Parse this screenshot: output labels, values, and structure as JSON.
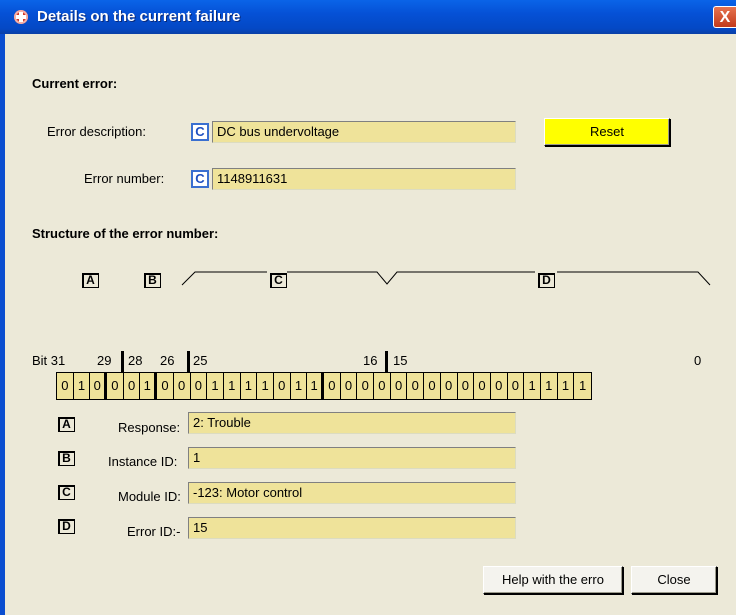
{
  "window": {
    "title": "Details on the current failure",
    "close_glyph": "X"
  },
  "current": {
    "heading": "Current error:",
    "desc_label": "Error description:",
    "desc_value": "DC bus undervoltage",
    "number_label": "Error number:",
    "number_value": "1148911631",
    "c_badge": "C",
    "reset_label": "Reset"
  },
  "structure": {
    "heading": "Structure of the error number:",
    "group_labels": [
      "A",
      "B",
      "C",
      "D"
    ],
    "bit_labels": [
      "Bit 31",
      "29",
      "28",
      "26",
      "25",
      "16",
      "15",
      "0"
    ],
    "bits": [
      "0",
      "1",
      "0",
      "0",
      "0",
      "1",
      "0",
      "0",
      "0",
      "1",
      "1",
      "1",
      "1",
      "0",
      "1",
      "1",
      "0",
      "0",
      "0",
      "0",
      "0",
      "0",
      "0",
      "0",
      "0",
      "0",
      "0",
      "0",
      "1",
      "1",
      "1",
      "1"
    ]
  },
  "fields": [
    {
      "tag": "A",
      "label": "Response:",
      "value": "2: Trouble"
    },
    {
      "tag": "B",
      "label": "Instance ID:",
      "value": "1"
    },
    {
      "tag": "C",
      "label": "Module ID:",
      "value": "-123: Motor control"
    },
    {
      "tag": "D",
      "label": "Error ID:-",
      "value": "15"
    }
  ],
  "buttons": {
    "help_label": "Help with the erro",
    "close_label": "Close"
  },
  "colors": {
    "field_bg": "#efe39a",
    "reset_bg": "#ffff00",
    "titlebar": "#0551d6"
  }
}
